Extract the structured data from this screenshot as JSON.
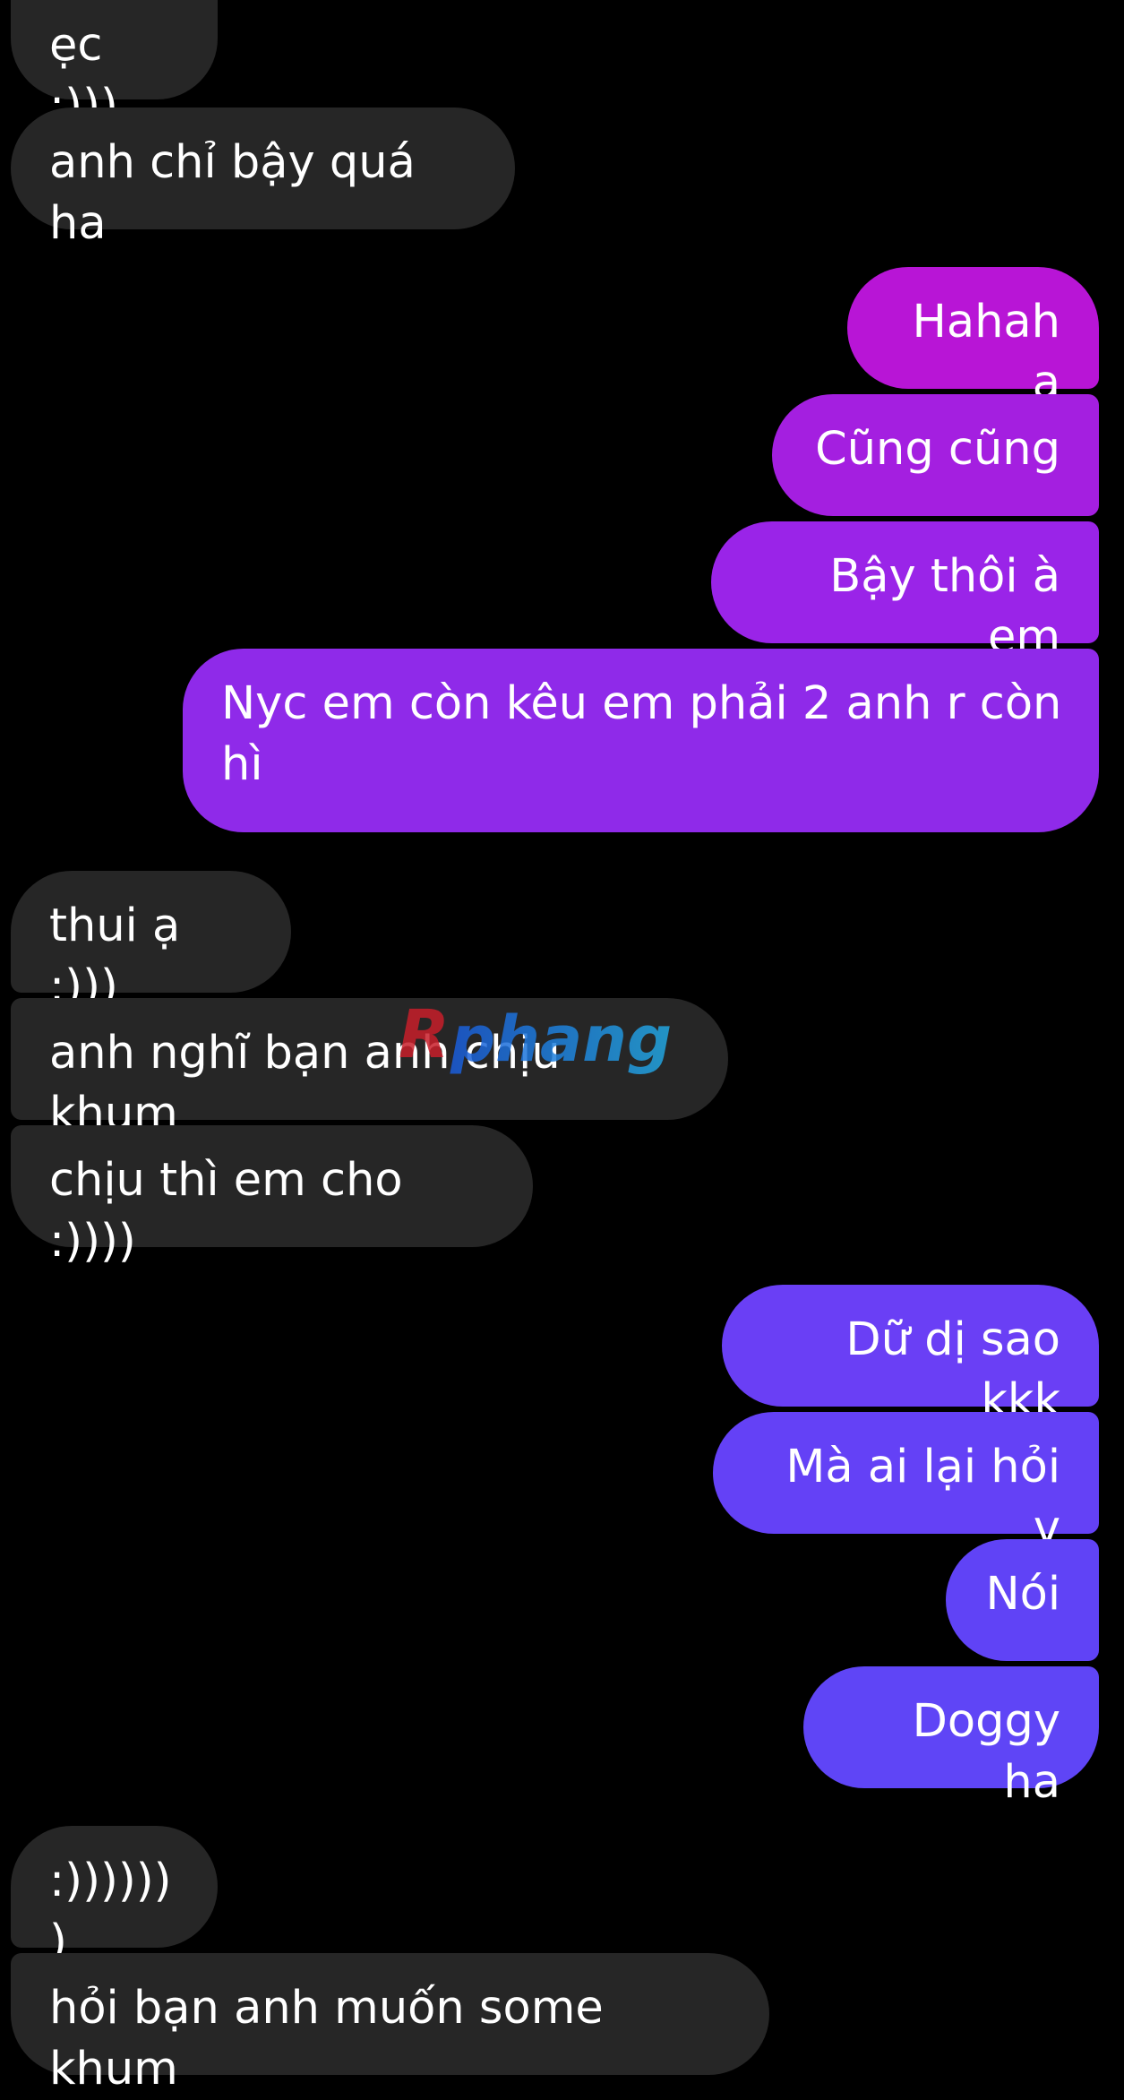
{
  "messages": [
    {
      "side": "in",
      "text": "ẹc :)))"
    },
    {
      "side": "in",
      "text": "anh chỉ bậy quá ha"
    },
    {
      "side": "out",
      "text": "Hahaha"
    },
    {
      "side": "out",
      "text": "Cũng cũng"
    },
    {
      "side": "out",
      "text": "Bậy thôi à em"
    },
    {
      "side": "out",
      "text": "Nyc em còn kêu em phải 2 anh r còn hì"
    },
    {
      "side": "in",
      "text": "thui ạ :)))"
    },
    {
      "side": "in",
      "text": "anh nghĩ bạn anh chịu khum"
    },
    {
      "side": "in",
      "text": "chịu thì em cho :))))"
    },
    {
      "side": "out",
      "text": "Dữ dị sao kkk"
    },
    {
      "side": "out",
      "text": "Mà ai lại hỏi v"
    },
    {
      "side": "out",
      "text": "Nói"
    },
    {
      "side": "out",
      "text": "Doggy ha"
    },
    {
      "side": "in",
      "text": ":)))))))"
    },
    {
      "side": "in",
      "text": "hỏi bạn anh muốn some khum"
    }
  ],
  "watermark": {
    "text": "Rphang"
  },
  "colors": {
    "background": "#000000",
    "incoming_bubble": "#262626",
    "outgoing_gradient": [
      "#b815d6",
      "#a41fe0",
      "#9a24e8",
      "#8a2cf0",
      "#6a3ff5",
      "#5f45f6"
    ],
    "text": "#ffffff"
  }
}
